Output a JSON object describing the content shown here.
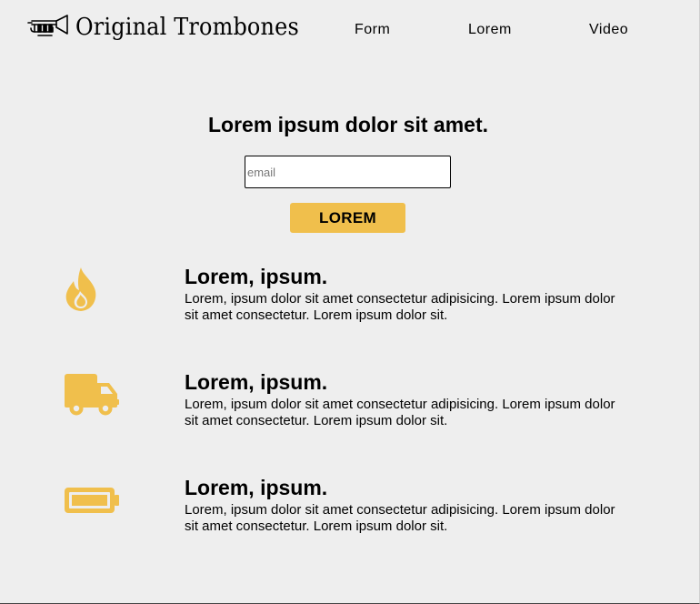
{
  "brand": {
    "name": "Original Trombones",
    "icon": "trombone-icon"
  },
  "nav": {
    "items": [
      {
        "label": "Form"
      },
      {
        "label": "Lorem"
      },
      {
        "label": "Video"
      }
    ]
  },
  "hero": {
    "title": "Lorem ipsum dolor sit amet.",
    "email_placeholder": "email",
    "email_value": "",
    "button_label": "LOREM"
  },
  "features": [
    {
      "icon": "fire-icon",
      "title": "Lorem, ipsum.",
      "description": "Lorem, ipsum dolor sit amet consectetur adipisicing. Lorem ipsum dolor sit amet consectetur. Lorem ipsum dolor sit."
    },
    {
      "icon": "truck-icon",
      "title": "Lorem, ipsum.",
      "description": "Lorem, ipsum dolor sit amet consectetur adipisicing. Lorem ipsum dolor sit amet consectetur. Lorem ipsum dolor sit."
    },
    {
      "icon": "battery-full-icon",
      "title": "Lorem, ipsum.",
      "description": "Lorem, ipsum dolor sit amet consectetur adipisicing. Lorem ipsum dolor sit amet consectetur. Lorem ipsum dolor sit."
    }
  ],
  "colors": {
    "background": "#eeeeee",
    "accent": "#f0bf4c",
    "text": "#000000"
  }
}
